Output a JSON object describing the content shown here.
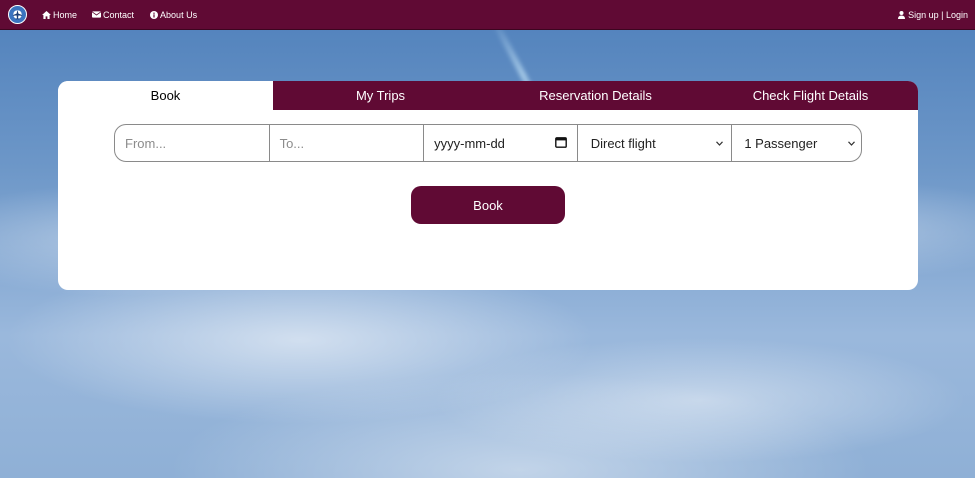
{
  "navbar": {
    "home_label": "Home",
    "contact_label": "Contact",
    "about_label": "About Us",
    "auth_label": "Sign up | Login"
  },
  "tabs": [
    {
      "label": "Book",
      "active": true
    },
    {
      "label": "My Trips",
      "active": false
    },
    {
      "label": "Reservation Details",
      "active": false
    },
    {
      "label": "Check Flight Details",
      "active": false
    }
  ],
  "form": {
    "from_placeholder": "From...",
    "to_placeholder": "To...",
    "date_placeholder": "yyyy-mm-dd",
    "flight_type_selected": "Direct flight",
    "passengers_selected": "1 Passenger",
    "submit_label": "Book"
  },
  "colors": {
    "brand": "#600a34",
    "panel_bg": "#ffffff"
  }
}
